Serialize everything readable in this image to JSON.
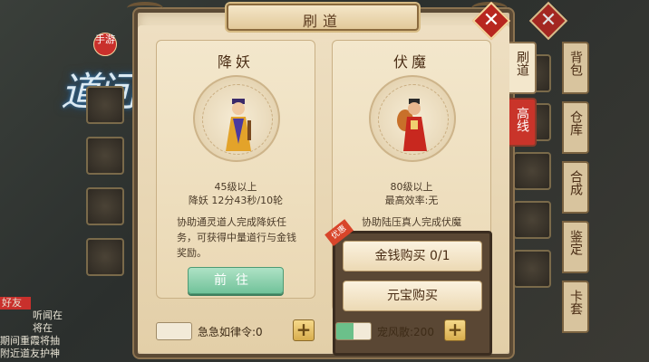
{
  "game": {
    "logo_text": "问道",
    "logo_tag": "手游"
  },
  "panel": {
    "title": "刷道"
  },
  "cards": [
    {
      "title": "降妖",
      "level": "45级以上",
      "stat": "降妖 12分43秒/10轮",
      "desc": "协助通灵道人完成降妖任务，可获得中量道行与金钱奖励。",
      "button": "前往"
    },
    {
      "title": "伏魔",
      "level": "80级以上",
      "stat": "最高效率:无",
      "desc": "协助陆压真人完成伏魔",
      "buy_money": "金钱购买 0/1",
      "buy_gold": "元宝购买",
      "ribbon": "优惠"
    }
  ],
  "bottom": {
    "left_item": "急急如律令:0",
    "right_item": "宠风散:200",
    "plus": "+"
  },
  "side_tabs": {
    "active": "刷道",
    "red": "高线",
    "outer": [
      "背包",
      "仓库",
      "合成",
      "鉴定",
      "卡套"
    ]
  },
  "chat": [
    "好友",
    "听闻在",
    "将在",
    "期间重霞将抽",
    "附近道友护神"
  ],
  "colors": {
    "panel_bg": "#eadbbd",
    "accent_red": "#b8261f",
    "go_green": "#71c29a"
  }
}
